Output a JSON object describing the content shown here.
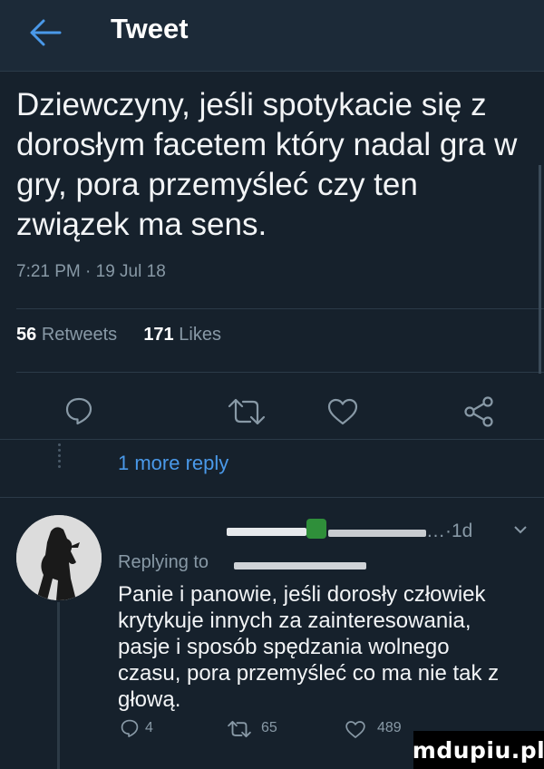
{
  "header": {
    "title": "Tweet"
  },
  "tweet": {
    "text": "Dziewczyny, jeśli spotykacie się z dorosłym facetem który nadal gra w gry, pora przemyśleć czy ten związek ma sens.",
    "timestamp": "7:21 PM · 19 Jul 18",
    "retweets_count": "56",
    "retweets_label": "Retweets",
    "likes_count": "171",
    "likes_label": "Likes"
  },
  "thread": {
    "more_reply": "1 more reply"
  },
  "reply": {
    "time": "1d",
    "replying_to": "Replying to",
    "text": "Panie i panowie, jeśli dorosły człowiek krytykuje innych za zainteresowania, pasje i sposób spędzania wolnego czasu, pora przemyśleć co ma nie tak z głową.",
    "comments": "4",
    "retweets": "65",
    "likes": "489"
  },
  "watermark": "mdupiu.pl",
  "colors": {
    "background": "#16212c",
    "accent": "#4a99e9",
    "muted": "#8899a6"
  }
}
